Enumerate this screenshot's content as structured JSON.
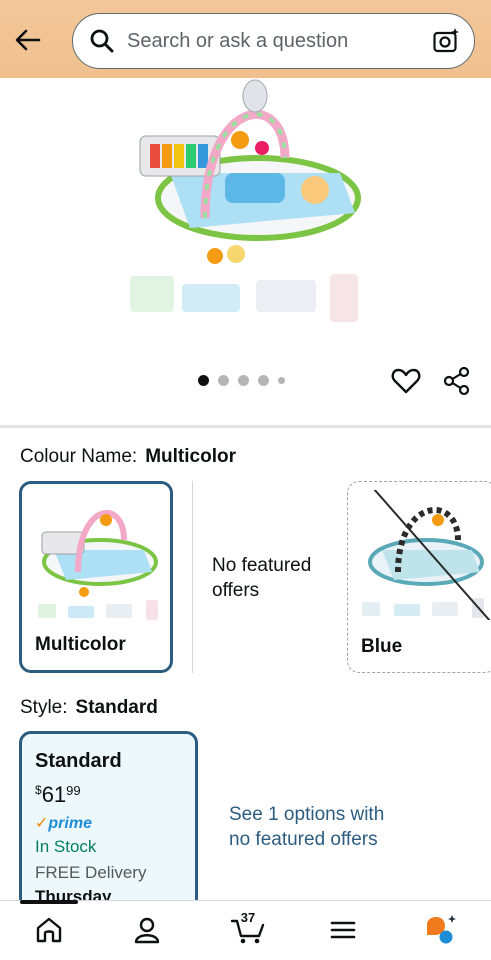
{
  "header": {
    "search_placeholder": "Search or ask a question",
    "icons": [
      "back-arrow-icon",
      "search-icon",
      "camera-icon"
    ]
  },
  "gallery": {
    "dot_count": 5,
    "active_dot": 0
  },
  "colour": {
    "label": "Colour Name:",
    "selected": "Multicolor",
    "options": [
      {
        "name": "Multicolor",
        "selected": true
      },
      {
        "name": "No featured offers"
      },
      {
        "name": "Blue",
        "unavailable": true
      }
    ]
  },
  "style": {
    "label": "Style:",
    "selected": "Standard",
    "card": {
      "title": "Standard",
      "price_symbol": "$",
      "price_whole": "61",
      "price_cents": "99",
      "prime": "prime",
      "stock": "In Stock",
      "delivery": "FREE Delivery",
      "delivery_day": "Thursday"
    },
    "see_options": "See 1 options with no featured offers"
  },
  "bottom_nav": {
    "cart_count": "37",
    "items": [
      "home-icon",
      "account-icon",
      "cart-icon",
      "menu-icon",
      "rufus-icon"
    ]
  },
  "colors": {
    "header_bg": "#f0c08f",
    "selected_border": "#2c5d81",
    "selected_fill": "#edf8fd",
    "stock_green": "#067d62",
    "prime_blue": "#1f8dd6",
    "prime_orange": "#f08804",
    "link_blue": "#2c5d81"
  }
}
